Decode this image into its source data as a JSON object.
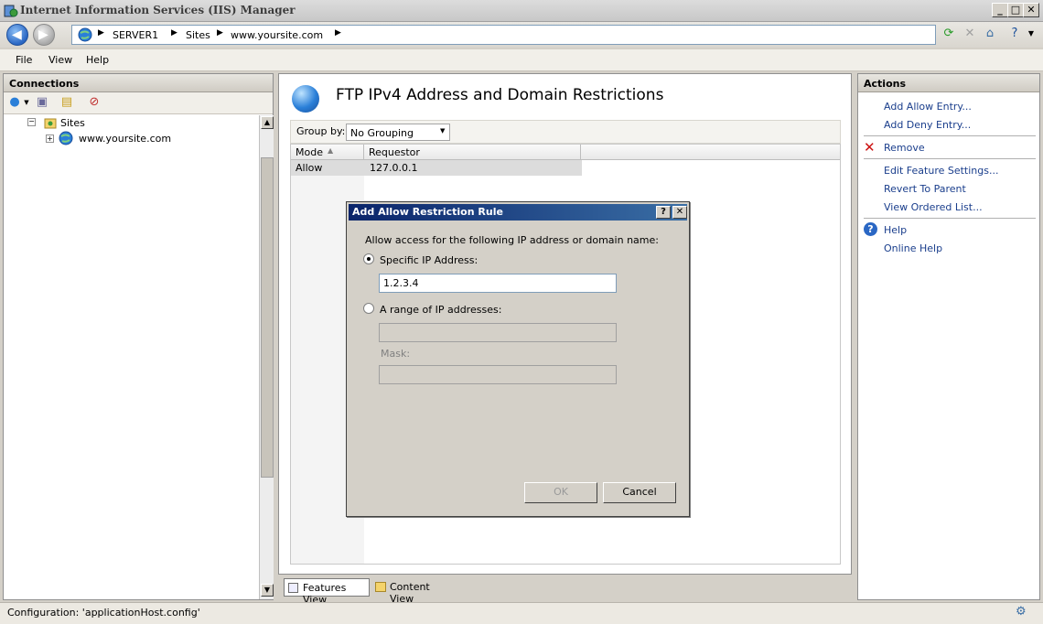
{
  "window": {
    "title": "Internet Information Services (IIS) Manager",
    "min": "_",
    "max": "□",
    "close": "✕"
  },
  "address": {
    "crumbs": [
      "SERVER1",
      "Sites",
      "www.yoursite.com"
    ]
  },
  "menu": [
    "File",
    "View",
    "Help"
  ],
  "connections": {
    "header": "Connections",
    "tree": [
      {
        "label": "Sites",
        "expander": "−"
      },
      {
        "label": "www.yoursite.com",
        "expander": "+"
      }
    ]
  },
  "feature": {
    "title": "FTP IPv4 Address and Domain Restrictions",
    "group_by_label": "Group by:",
    "group_by_value": "No Grouping",
    "columns": [
      "Mode",
      "Requestor"
    ],
    "rows": [
      {
        "mode": "Allow",
        "requestor": "127.0.0.1"
      }
    ]
  },
  "bottom_tabs": [
    "Features View",
    "Content View"
  ],
  "actions": {
    "header": "Actions",
    "items": [
      "Add Allow Entry...",
      "Add Deny Entry...",
      "Remove",
      "Edit Feature Settings...",
      "Revert To Parent",
      "View Ordered List...",
      "Help",
      "Online Help"
    ]
  },
  "status": {
    "text": "Configuration: 'applicationHost.config'"
  },
  "dialog": {
    "title": "Add Allow Restriction Rule",
    "help_btn": "?",
    "close_btn": "✕",
    "prompt": "Allow access for the following IP address or domain name:",
    "specific_label": "Specific IP Address:",
    "specific_value": "1.2.3.4",
    "range_label": "A range of IP addresses:",
    "range_value": "",
    "mask_label": "Mask:",
    "mask_value": "",
    "ok": "OK",
    "cancel": "Cancel"
  },
  "colors": {
    "link": "#1a3e8c",
    "dialog_title": "#0a246a",
    "remove": "#cc1111"
  }
}
